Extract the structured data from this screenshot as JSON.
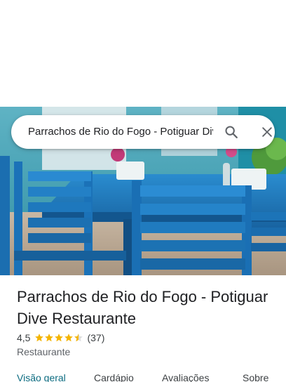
{
  "search": {
    "value": "Parrachos de Rio do Fogo - Potiguar Dive Restaurante",
    "search_icon": "search-icon",
    "close_icon": "close-icon"
  },
  "place": {
    "name": "Parrachos de Rio do Fogo - Potiguar Dive Restaurante",
    "rating": "4,5",
    "stars": 4.5,
    "review_count": "(37)",
    "category": "Restaurante"
  },
  "tabs": [
    {
      "label": "Visão geral",
      "active": true
    },
    {
      "label": "Cardápio",
      "active": false
    },
    {
      "label": "Avaliações",
      "active": false
    },
    {
      "label": "Sobre",
      "active": false
    }
  ],
  "colors": {
    "accent": "#0b6b80",
    "star": "#f4b400",
    "furniture_blue": "#1f7fc7"
  }
}
